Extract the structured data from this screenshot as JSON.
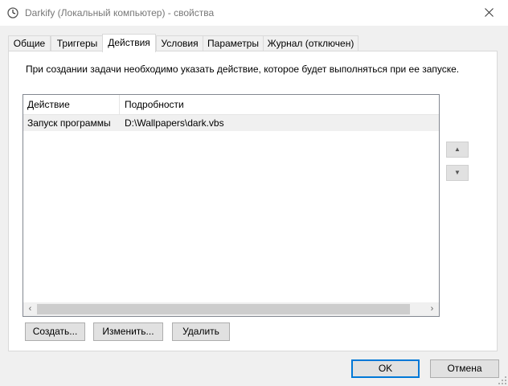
{
  "window": {
    "title": "Darkify (Локальный компьютер) - свойства",
    "icon": "task-scheduler-clock-icon"
  },
  "tabs": [
    {
      "label": "Общие"
    },
    {
      "label": "Триггеры"
    },
    {
      "label": "Действия",
      "active": true
    },
    {
      "label": "Условия"
    },
    {
      "label": "Параметры"
    },
    {
      "label": "Журнал (отключен)"
    }
  ],
  "actions_tab": {
    "description": "При создании задачи необходимо указать действие, которое будет выполняться при ее запуске.",
    "columns": [
      "Действие",
      "Подробности"
    ],
    "rows": [
      {
        "action": "Запуск программы",
        "details": "D:\\Wallpapers\\dark.vbs"
      }
    ],
    "buttons": {
      "create": "Создать...",
      "edit": "Изменить...",
      "delete": "Удалить"
    },
    "move_up_icon": "triangle-up-icon",
    "move_down_icon": "triangle-down-icon"
  },
  "dialog_buttons": {
    "ok": "OK",
    "cancel": "Отмена"
  },
  "colors": {
    "accent": "#0078d7",
    "selected_row": "#f0f0f0"
  }
}
